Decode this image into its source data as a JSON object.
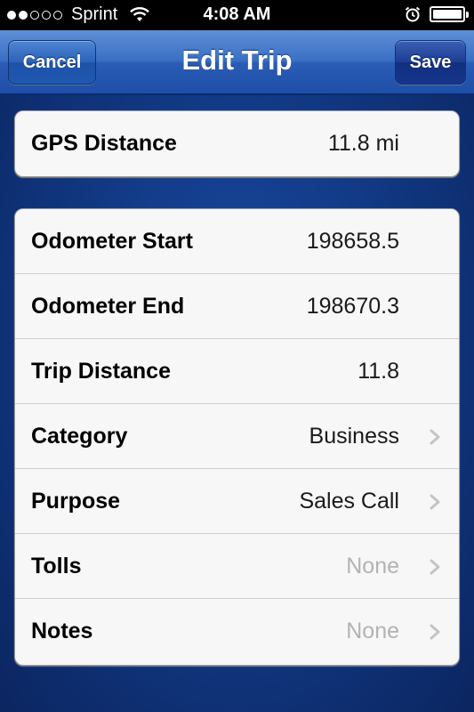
{
  "status_bar": {
    "carrier": "Sprint",
    "time": "4:08 AM",
    "signal_bars_filled": 2,
    "signal_bars_total": 5,
    "battery_level": 1.0
  },
  "nav": {
    "title": "Edit Trip",
    "cancel_label": "Cancel",
    "save_label": "Save"
  },
  "gps": {
    "label": "GPS Distance",
    "value": "11.8 mi"
  },
  "rows": [
    {
      "label": "Odometer Start",
      "value": "198658.5"
    },
    {
      "label": "Odometer End",
      "value": "198670.3"
    },
    {
      "label": "Trip Distance",
      "value": "11.8"
    },
    {
      "label": "Category",
      "value": "Business"
    },
    {
      "label": "Purpose",
      "value": "Sales Call"
    },
    {
      "label": "Tolls",
      "value": "None"
    },
    {
      "label": "Notes",
      "value": "None"
    }
  ],
  "colors": {
    "nav_blue": "#2a5db6",
    "background_blue": "#123a86",
    "placeholder_gray": "#b3b3b3"
  }
}
